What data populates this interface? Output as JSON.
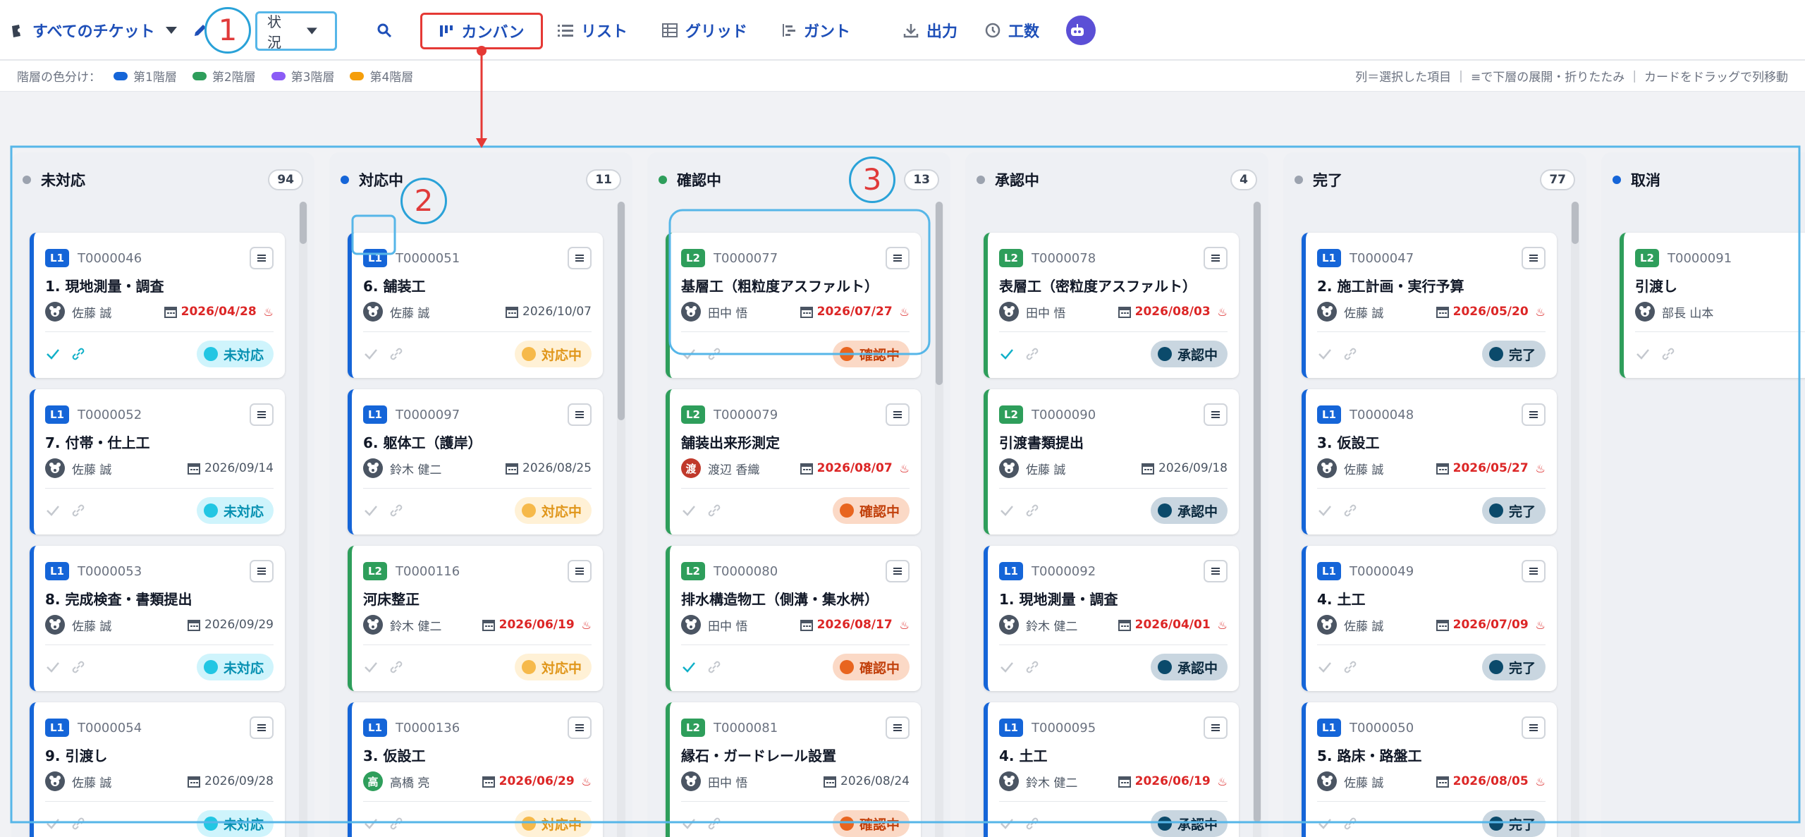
{
  "toolbar": {
    "ticket_filter": "すべてのチケット",
    "status_select": "状況",
    "views": [
      "カンバン",
      "リスト",
      "グリッド",
      "ガント"
    ],
    "export_label": "出力",
    "effort_label": "工数"
  },
  "legend": {
    "label": "階層の色分け：",
    "items": [
      {
        "name": "第1階層",
        "color": "#1565d8"
      },
      {
        "name": "第2階層",
        "color": "#2e9e5b"
      },
      {
        "name": "第3階層",
        "color": "#8b5cf6"
      },
      {
        "name": "第4階層",
        "color": "#f59e0b"
      }
    ],
    "hint": "列＝選択した項目 ｜ ≡で下層の展開・折りたたみ ｜ カードをドラッグで列移動"
  },
  "annotations": [
    "1",
    "2",
    "3"
  ],
  "columns": [
    {
      "title": "未対応",
      "count": "94",
      "dot_color": "#9ca3af",
      "badge_label": "未対応",
      "badge_bg": "#cff4fc",
      "badge_dot": "#22c6e3",
      "badge_text": "#0891b2",
      "cards": [
        {
          "level": "L1",
          "id": "T0000046",
          "title": "1. 現地測量・調査",
          "assignee": "佐藤 誠",
          "date": "2026/04/28",
          "urgent": true,
          "checked": true,
          "link_active": true
        },
        {
          "level": "L1",
          "id": "T0000052",
          "title": "7. 付帯・仕上工",
          "assignee": "佐藤 誠",
          "date": "2026/09/14",
          "urgent": false,
          "checked": false,
          "link_active": false
        },
        {
          "level": "L1",
          "id": "T0000053",
          "title": "8. 完成検査・書類提出",
          "assignee": "佐藤 誠",
          "date": "2026/09/29",
          "urgent": false,
          "checked": false,
          "link_active": false
        },
        {
          "level": "L1",
          "id": "T0000054",
          "title": "9. 引渡し",
          "assignee": "佐藤 誠",
          "date": "2026/09/28",
          "urgent": false,
          "checked": false,
          "link_active": false
        }
      ]
    },
    {
      "title": "対応中",
      "count": "11",
      "dot_color": "#1565d8",
      "badge_label": "対応中",
      "badge_bg": "#fff1d6",
      "badge_dot": "#f6b94a",
      "badge_text": "#e0961a",
      "cards": [
        {
          "level": "L1",
          "id": "T0000051",
          "title": "6. 舗装工",
          "assignee": "佐藤 誠",
          "date": "2026/10/07",
          "urgent": false,
          "checked": false,
          "link_active": false
        },
        {
          "level": "L1",
          "id": "T0000097",
          "title": "6. 躯体工（護岸）",
          "assignee": "鈴木 健二",
          "date": "2026/08/25",
          "urgent": false,
          "checked": false,
          "link_active": false
        },
        {
          "level": "L2",
          "id": "T0000116",
          "title": "河床整正",
          "assignee": "鈴木 健二",
          "date": "2026/06/19",
          "urgent": true,
          "checked": false,
          "link_active": false
        },
        {
          "level": "L1",
          "id": "T0000136",
          "title": "3. 仮設工",
          "assignee": "高橋 亮",
          "avatar_text": "高",
          "avatar_color": "#2e9e5b",
          "date": "2026/06/29",
          "urgent": true,
          "checked": false,
          "link_active": false
        }
      ]
    },
    {
      "title": "確認中",
      "count": "13",
      "dot_color": "#2e9e5b",
      "badge_label": "確認中",
      "badge_bg": "#fbd9c6",
      "badge_dot": "#e8651f",
      "badge_text": "#c2410c",
      "cards": [
        {
          "level": "L2",
          "id": "T0000077",
          "title": "基層工（粗粒度アスファルト）",
          "assignee": "田中 悟",
          "date": "2026/07/27",
          "urgent": true,
          "checked": false,
          "link_active": false
        },
        {
          "level": "L2",
          "id": "T0000079",
          "title": "舗装出来形測定",
          "assignee": "渡辺 香織",
          "avatar_text": "渡",
          "avatar_color": "#c0392b",
          "date": "2026/08/07",
          "urgent": true,
          "checked": false,
          "link_active": false
        },
        {
          "level": "L2",
          "id": "T0000080",
          "title": "排水構造物工（側溝・集水桝）",
          "assignee": "田中 悟",
          "date": "2026/08/17",
          "urgent": true,
          "checked": true,
          "link_active": false
        },
        {
          "level": "L2",
          "id": "T0000081",
          "title": "縁石・ガードレール設置",
          "assignee": "田中 悟",
          "date": "2026/08/24",
          "urgent": false,
          "checked": false,
          "link_active": false
        }
      ]
    },
    {
      "title": "承認中",
      "count": "4",
      "dot_color": "#9ca3af",
      "badge_label": "承認中",
      "badge_bg": "#c9d6e0",
      "badge_dot": "#0b4a6b",
      "badge_text": "#0b2a3f",
      "cards": [
        {
          "level": "L2",
          "id": "T0000078",
          "title": "表層工（密粒度アスファルト）",
          "assignee": "田中 悟",
          "date": "2026/08/03",
          "urgent": true,
          "checked": true,
          "link_active": false
        },
        {
          "level": "L2",
          "id": "T0000090",
          "title": "引渡書類提出",
          "assignee": "佐藤 誠",
          "date": "2026/09/18",
          "urgent": false,
          "checked": false,
          "link_active": false
        },
        {
          "level": "L1",
          "id": "T0000092",
          "title": "1. 現地測量・調査",
          "assignee": "鈴木 健二",
          "date": "2026/04/01",
          "urgent": true,
          "checked": false,
          "link_active": false
        },
        {
          "level": "L1",
          "id": "T0000095",
          "title": "4. 土工",
          "assignee": "鈴木 健二",
          "date": "2026/06/19",
          "urgent": true,
          "checked": false,
          "link_active": false
        }
      ]
    },
    {
      "title": "完了",
      "count": "77",
      "dot_color": "#9ca3af",
      "badge_label": "完了",
      "badge_bg": "#c9d6e0",
      "badge_dot": "#0b4a6b",
      "badge_text": "#0b2a3f",
      "cards": [
        {
          "level": "L1",
          "id": "T0000047",
          "title": "2. 施工計画・実行予算",
          "assignee": "佐藤 誠",
          "date": "2026/05/20",
          "urgent": true,
          "checked": false,
          "link_active": false
        },
        {
          "level": "L1",
          "id": "T0000048",
          "title": "3. 仮設工",
          "assignee": "佐藤 誠",
          "date": "2026/05/27",
          "urgent": true,
          "checked": false,
          "link_active": false
        },
        {
          "level": "L1",
          "id": "T0000049",
          "title": "4. 土工",
          "assignee": "佐藤 誠",
          "date": "2026/07/09",
          "urgent": true,
          "checked": false,
          "link_active": false
        },
        {
          "level": "L1",
          "id": "T0000050",
          "title": "5. 路床・路盤工",
          "assignee": "佐藤 誠",
          "date": "2026/08/05",
          "urgent": true,
          "checked": false,
          "link_active": false
        }
      ]
    },
    {
      "title": "取消",
      "count": "",
      "dot_color": "#1565d8",
      "badge_label": "",
      "badge_bg": "#c9d6e0",
      "badge_dot": "#0b4a6b",
      "badge_text": "#0b2a3f",
      "cards": [
        {
          "level": "L2",
          "id": "T0000091",
          "title": "引渡し",
          "assignee": "部長 山本",
          "date": "",
          "urgent": false,
          "checked": false,
          "link_active": false
        }
      ]
    }
  ]
}
